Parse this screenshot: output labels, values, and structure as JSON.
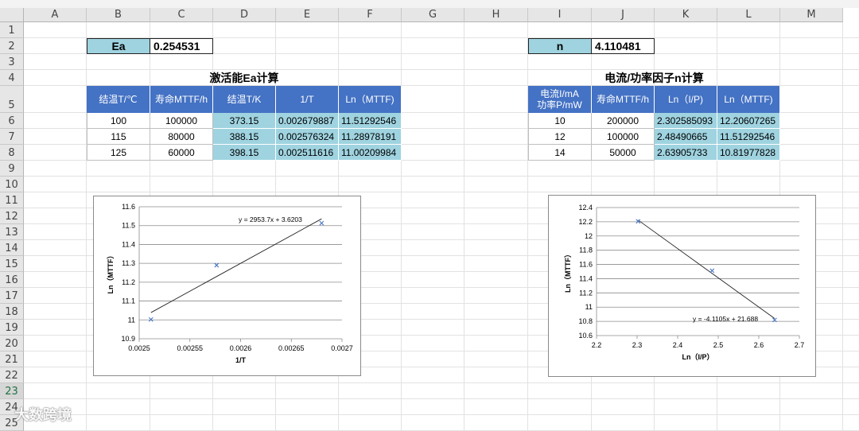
{
  "columns": [
    "A",
    "B",
    "C",
    "D",
    "E",
    "F",
    "G",
    "H",
    "I",
    "J",
    "K",
    "L",
    "M"
  ],
  "rows": [
    "1",
    "2",
    "3",
    "4",
    "5",
    "6",
    "7",
    "8",
    "9",
    "10",
    "11",
    "12",
    "13",
    "14",
    "15",
    "16",
    "17",
    "18",
    "19",
    "20",
    "21",
    "22",
    "23",
    "24",
    "25"
  ],
  "selected_row": "23",
  "ea": {
    "label": "Ea",
    "value": "0.254531"
  },
  "n": {
    "label": "n",
    "value": "4.110481"
  },
  "table1": {
    "title": "激活能Ea计算",
    "headers": [
      "结温T/℃",
      "寿命MTTF/h",
      "结温T/K",
      "1/T",
      "Ln（MTTF)"
    ],
    "rows": [
      [
        "100",
        "100000",
        "373.15",
        "0.002679887",
        "11.51292546"
      ],
      [
        "115",
        "80000",
        "388.15",
        "0.002576324",
        "11.28978191"
      ],
      [
        "125",
        "60000",
        "398.15",
        "0.002511616",
        "11.00209984"
      ]
    ]
  },
  "table2": {
    "title": "电流/功率因子n计算",
    "headers": [
      "电流I/mA\n功率P/mW",
      "寿命MTTF/h",
      "Ln（I/P)",
      "Ln（MTTF)"
    ],
    "rows": [
      [
        "10",
        "200000",
        "2.302585093",
        "12.20607265"
      ],
      [
        "12",
        "100000",
        "2.48490665",
        "11.51292546"
      ],
      [
        "14",
        "50000",
        "2.63905733",
        "10.81977828"
      ]
    ]
  },
  "chart_data": [
    {
      "type": "scatter",
      "x": [
        0.002679887,
        0.002576324,
        0.002511616
      ],
      "y": [
        11.51292546,
        11.28978191,
        11.00209984
      ],
      "trendline": {
        "slope": 2953.7,
        "intercept": 3.6203,
        "equation": "y = 2953.7x + 3.6203"
      },
      "xlabel": "1/T",
      "ylabel": "Ln（MTTF）",
      "xlim": [
        0.0025,
        0.0027
      ],
      "ylim": [
        10.9,
        11.6
      ],
      "xticks": [
        "0.0025",
        "0.00255",
        "0.0026",
        "0.00265",
        "0.0027"
      ],
      "yticks": [
        "10.9",
        "11",
        "11.1",
        "11.2",
        "11.3",
        "11.4",
        "11.5",
        "11.6"
      ],
      "grid": "horizontal",
      "marker_color": "#4472c4"
    },
    {
      "type": "scatter",
      "x": [
        2.302585093,
        2.48490665,
        2.63905733
      ],
      "y": [
        12.20607265,
        11.51292546,
        10.81977828
      ],
      "trendline": {
        "slope": -4.1105,
        "intercept": 21.688,
        "equation": "y = -4.1105x + 21.688"
      },
      "xlabel": "Ln（I/P）",
      "ylabel": "Ln（MTTF）",
      "xlim": [
        2.2,
        2.7
      ],
      "ylim": [
        10.6,
        12.4
      ],
      "xticks": [
        "2.2",
        "2.3",
        "2.4",
        "2.5",
        "2.6",
        "2.7"
      ],
      "yticks": [
        "10.6",
        "10.8",
        "11",
        "11.2",
        "11.4",
        "11.6",
        "11.8",
        "12",
        "12.2",
        "12.4"
      ],
      "grid": "horizontal",
      "marker_color": "#4472c4"
    }
  ],
  "watermark": "大数跨境"
}
